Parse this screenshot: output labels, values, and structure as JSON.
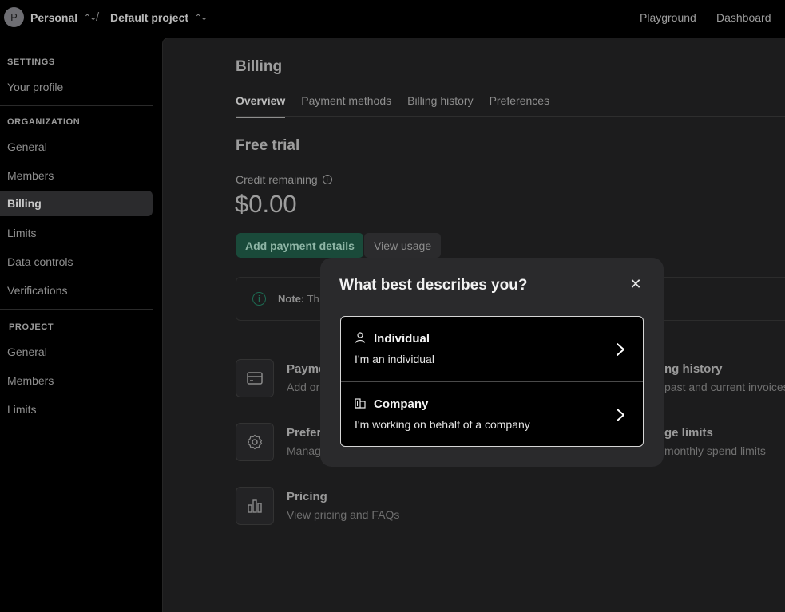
{
  "topbar": {
    "avatar_letter": "P",
    "org": "Personal",
    "project": "Default project",
    "separator": "/",
    "links": [
      "Playground",
      "Dashboard"
    ]
  },
  "sidebar": {
    "settings_head": "SETTINGS",
    "settings_items": [
      "Your profile"
    ],
    "org_head": "ORGANIZATION",
    "org_items": [
      "General",
      "Members",
      "Billing",
      "Limits",
      "Data controls",
      "Verifications"
    ],
    "project_head": "PROJECT",
    "project_items": [
      "General",
      "Members",
      "Limits"
    ],
    "active": "Billing"
  },
  "main": {
    "title": "Billing",
    "tabs": [
      "Overview",
      "Payment methods",
      "Billing history",
      "Preferences"
    ],
    "active_tab": "Overview",
    "section_title": "Free trial",
    "credit_label": "Credit remaining",
    "amount": "$0.00",
    "add_button": "Add payment details",
    "view_button": "View usage",
    "note_label": "Note:",
    "note_text": "Th",
    "cards": [
      {
        "title": "Payme",
        "sub": "Add or",
        "icon": "credit-card-icon"
      },
      {
        "title": "ng history",
        "sub": "past and current invoices",
        "icon": "history-icon"
      },
      {
        "title": "Prefer",
        "sub": "Manag",
        "icon": "gear-icon"
      },
      {
        "title": "ge limits",
        "sub": "monthly spend limits",
        "icon": "limits-icon"
      },
      {
        "title": "Pricing",
        "sub": "View pricing and FAQs",
        "icon": "chart-icon"
      }
    ]
  },
  "modal": {
    "title": "What best describes you?",
    "close_glyph": "✕",
    "options": [
      {
        "title": "Individual",
        "sub": "I'm an individual",
        "icon": "person-icon"
      },
      {
        "title": "Company",
        "sub": "I'm working on behalf of a company",
        "icon": "building-icon"
      }
    ]
  }
}
